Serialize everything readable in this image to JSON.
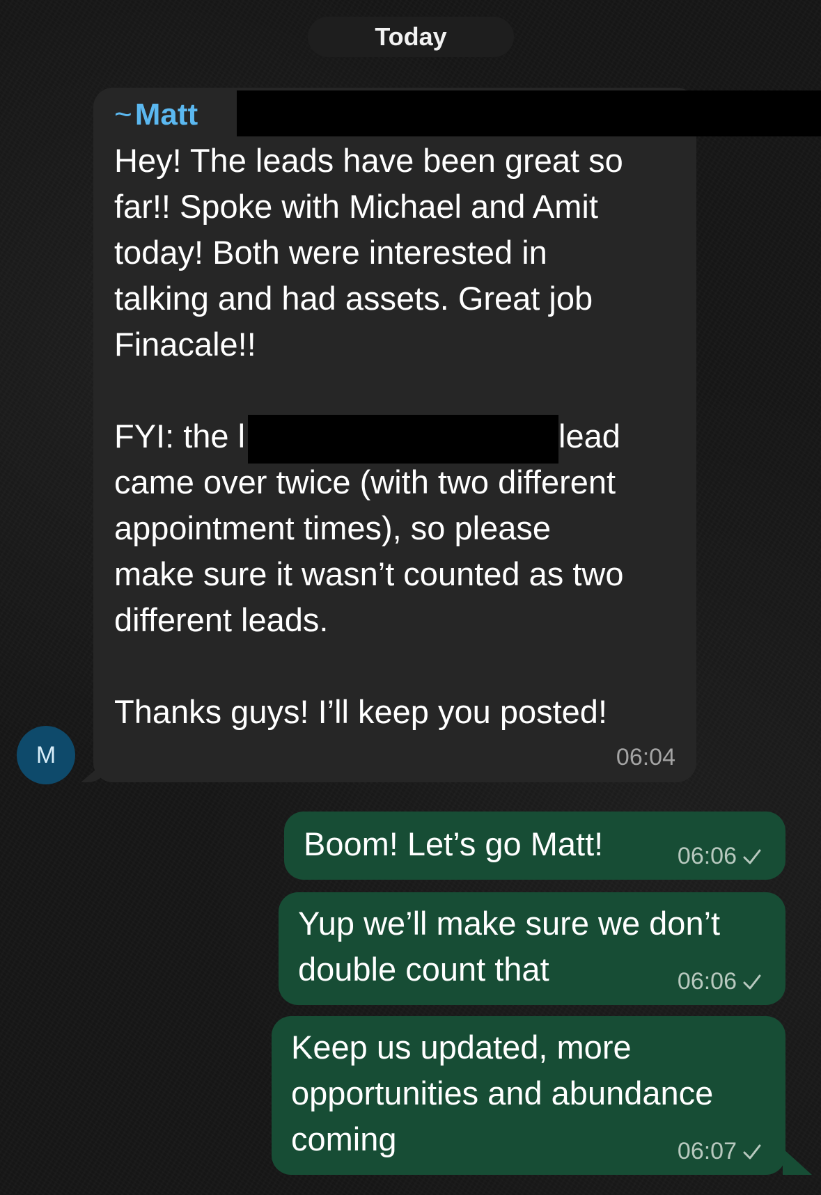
{
  "date_divider": "Today",
  "incoming": {
    "sender_prefix": "~",
    "sender_name": "Matt",
    "avatar_initial": "M",
    "lines": [
      "Hey! The leads have been great so",
      "far!! Spoke with Michael and Amit",
      "today! Both were interested in",
      "talking and had assets. Great job",
      "Finacale!!",
      "FYI: the l",
      "lead",
      "came over twice (with two different",
      "appointment times), so please",
      "make sure it wasn’t counted as two",
      "different leads.",
      "Thanks guys! I’ll keep you posted!"
    ],
    "time": "06:04"
  },
  "outgoing": [
    {
      "lines": [
        "Boom! Let’s go Matt!"
      ],
      "time": "06:06",
      "status": "sent-check-icon"
    },
    {
      "lines": [
        "Yup we’ll make sure we don’t",
        "double count that"
      ],
      "time": "06:06",
      "status": "sent-check-icon"
    },
    {
      "lines": [
        "Keep us updated, more",
        "opportunities and abundance",
        "coming"
      ],
      "time": "06:07",
      "status": "sent-check-icon"
    }
  ],
  "colors": {
    "incoming_bubble": "#262626",
    "outgoing_bubble": "#174d35",
    "sender_name": "#5bb8f0",
    "avatar": "#0e4a6b"
  }
}
